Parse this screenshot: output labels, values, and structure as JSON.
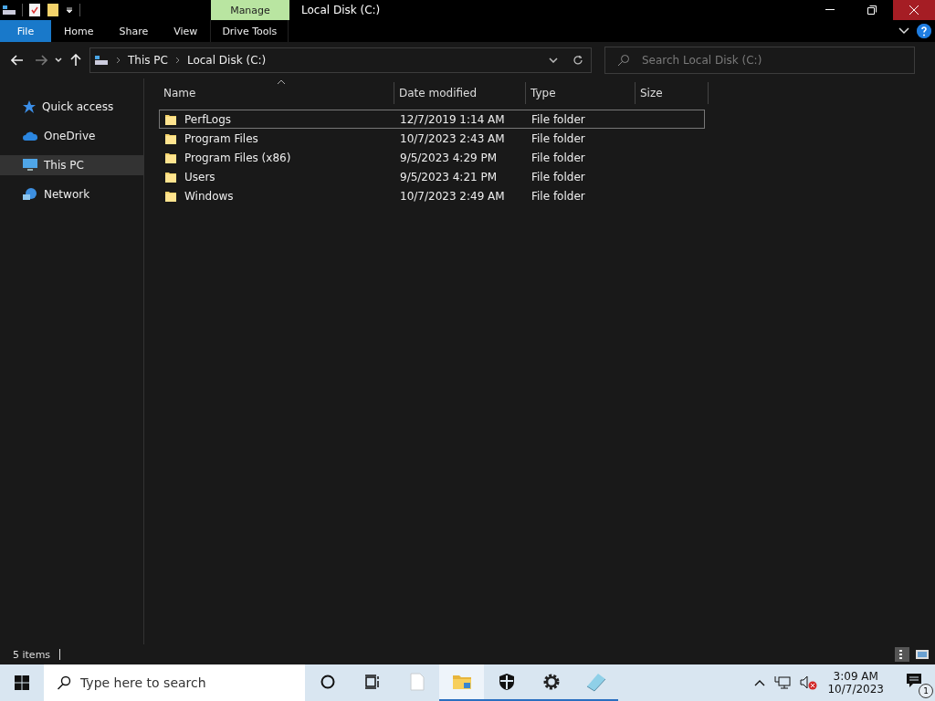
{
  "window": {
    "title": "Local Disk (C:)",
    "context_tab": "Manage"
  },
  "ribbon": {
    "tabs": [
      {
        "label": "File",
        "kind": "file"
      },
      {
        "label": "Home",
        "kind": "tab"
      },
      {
        "label": "Share",
        "kind": "tab"
      },
      {
        "label": "View",
        "kind": "tab"
      },
      {
        "label": "Drive Tools",
        "kind": "context"
      }
    ]
  },
  "address": {
    "crumbs": [
      "This PC",
      "Local Disk (C:)"
    ],
    "search": {
      "placeholder": "Search Local Disk (C:)"
    }
  },
  "nav": {
    "items": [
      {
        "label": "Quick access",
        "kind": "star",
        "selected": false
      },
      {
        "label": "OneDrive",
        "kind": "cloud",
        "selected": false
      },
      {
        "label": "This PC",
        "kind": "pc",
        "selected": true
      },
      {
        "label": "Network",
        "kind": "network",
        "selected": false
      }
    ]
  },
  "table": {
    "columns": [
      {
        "label": "Name",
        "sorted": true
      },
      {
        "label": "Date modified",
        "sorted": false
      },
      {
        "label": "Type",
        "sorted": false
      },
      {
        "label": "Size",
        "sorted": false
      }
    ],
    "rows": [
      {
        "name": "PerfLogs",
        "date": "12/7/2019 1:14 AM",
        "type": "File folder",
        "focused": true
      },
      {
        "name": "Program Files",
        "date": "10/7/2023 2:43 AM",
        "type": "File folder",
        "focused": false
      },
      {
        "name": "Program Files (x86)",
        "date": "9/5/2023 4:29 PM",
        "type": "File folder",
        "focused": false
      },
      {
        "name": "Users",
        "date": "9/5/2023 4:21 PM",
        "type": "File folder",
        "focused": false
      },
      {
        "name": "Windows",
        "date": "10/7/2023 2:49 AM",
        "type": "File folder",
        "focused": false
      }
    ]
  },
  "status_bar": {
    "count": "5 items"
  },
  "taskbar": {
    "search": {
      "placeholder": "Type here to search"
    },
    "apps": [
      {
        "kind": "document",
        "running": false,
        "active": false
      },
      {
        "kind": "explorer",
        "running": true,
        "active": true
      },
      {
        "kind": "shield",
        "running": true,
        "active": false
      },
      {
        "kind": "gear",
        "running": true,
        "active": false
      },
      {
        "kind": "notepad",
        "running": true,
        "active": false
      }
    ],
    "time": "3:09 AM",
    "date": "10/7/2023",
    "notifications": "1"
  }
}
